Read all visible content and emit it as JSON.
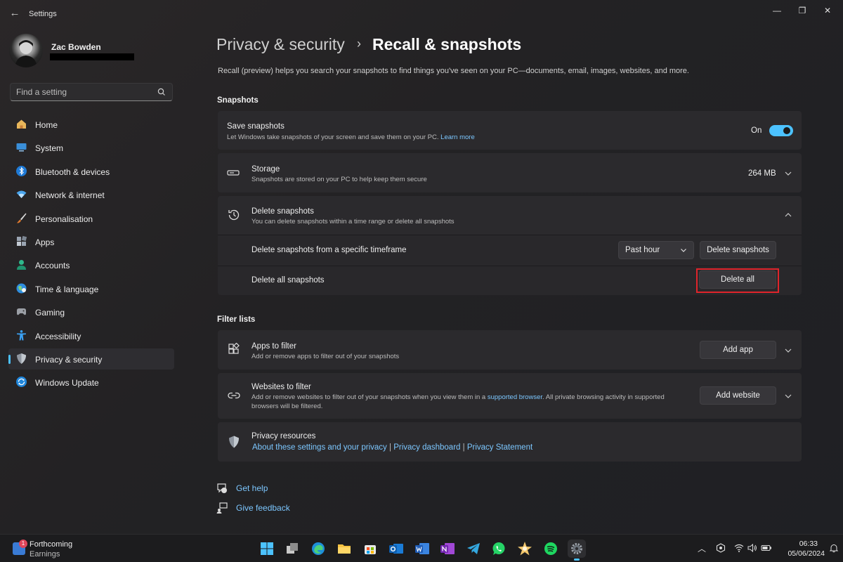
{
  "window": {
    "title": "Settings"
  },
  "profile": {
    "name": "Zac Bowden"
  },
  "search": {
    "placeholder": "Find a setting"
  },
  "sidebar": {
    "items": [
      {
        "label": "Home",
        "icon": "home-icon"
      },
      {
        "label": "System",
        "icon": "system-icon"
      },
      {
        "label": "Bluetooth & devices",
        "icon": "bluetooth-icon"
      },
      {
        "label": "Network & internet",
        "icon": "wifi-icon"
      },
      {
        "label": "Personalisation",
        "icon": "brush-icon"
      },
      {
        "label": "Apps",
        "icon": "apps-icon"
      },
      {
        "label": "Accounts",
        "icon": "person-icon"
      },
      {
        "label": "Time & language",
        "icon": "globe-icon"
      },
      {
        "label": "Gaming",
        "icon": "gamepad-icon"
      },
      {
        "label": "Accessibility",
        "icon": "accessibility-icon"
      },
      {
        "label": "Privacy & security",
        "icon": "shield-icon",
        "active": true
      },
      {
        "label": "Windows Update",
        "icon": "update-icon"
      }
    ]
  },
  "breadcrumb": {
    "parent": "Privacy & security",
    "separator": "›",
    "current": "Recall & snapshots"
  },
  "intro": "Recall (preview) helps you search your snapshots to find things you've seen on your PC—documents, email, images, websites, and more.",
  "snapshots": {
    "section_title": "Snapshots",
    "save": {
      "title": "Save snapshots",
      "desc": "Let Windows take snapshots of your screen and save them on your PC.",
      "link": "Learn more",
      "state_label": "On",
      "enabled": true
    },
    "storage": {
      "title": "Storage",
      "desc": "Snapshots are stored on your PC to help keep them secure",
      "value": "264 MB"
    },
    "delete": {
      "title": "Delete snapshots",
      "desc": "You can delete snapshots within a time range or delete all snapshots",
      "timeframe_label": "Delete snapshots from a specific timeframe",
      "timeframe_value": "Past hour",
      "timeframe_button": "Delete snapshots",
      "all_label": "Delete all snapshots",
      "all_button": "Delete all"
    }
  },
  "filters": {
    "section_title": "Filter lists",
    "apps": {
      "title": "Apps to filter",
      "desc": "Add or remove apps to filter out of your snapshots",
      "button": "Add app"
    },
    "websites": {
      "title": "Websites to filter",
      "desc_pre": "Add or remove websites to filter out of your snapshots when you view them in a ",
      "desc_link": "supported browser",
      "desc_post": ". All private browsing activity in supported browsers will be filtered.",
      "button": "Add website"
    },
    "privacy": {
      "title": "Privacy resources",
      "link1": "About these settings and your privacy",
      "sep": "|",
      "link2": "Privacy dashboard",
      "link3": "Privacy Statement"
    }
  },
  "help": {
    "get_help": "Get help",
    "give_feedback": "Give feedback"
  },
  "taskbar": {
    "weather": {
      "badge": "1",
      "title": "Forthcoming",
      "subtitle": "Earnings"
    },
    "apps": [
      "start-icon",
      "task-view-icon",
      "edge-icon",
      "file-explorer-icon",
      "store-icon",
      "outlook-icon",
      "word-icon",
      "onenote-icon",
      "telegram-icon",
      "whatsapp-icon",
      "photos-icon",
      "spotify-icon",
      "settings-icon"
    ],
    "time": "06:33",
    "date": "05/06/2024"
  },
  "colors": {
    "accent": "#4cc2ff",
    "link": "#7cc7ff",
    "highlight": "#e0242b"
  }
}
